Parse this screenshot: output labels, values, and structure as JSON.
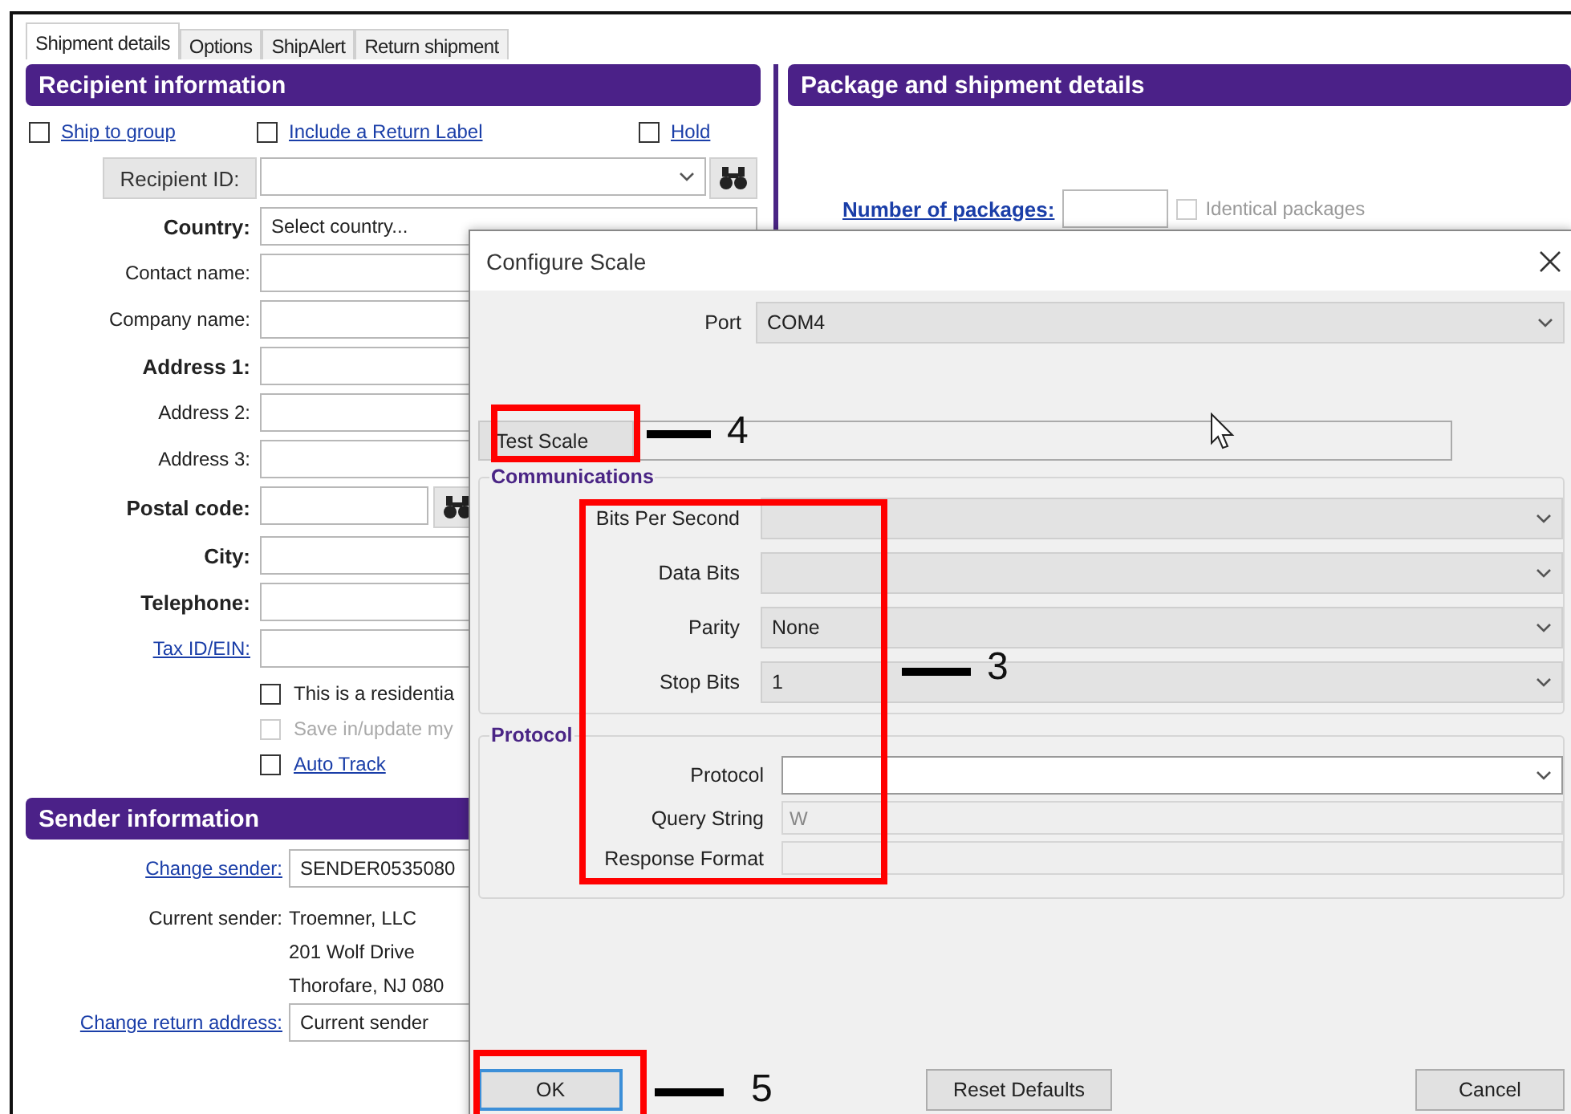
{
  "tabs": [
    {
      "label": "Shipment details",
      "selected": true
    },
    {
      "label": "Options",
      "selected": false
    },
    {
      "label": "ShipAlert",
      "selected": false
    },
    {
      "label": "Return shipment",
      "selected": false
    }
  ],
  "recipient": {
    "title": "Recipient information",
    "options": [
      {
        "label": "Ship to group",
        "checked": false
      },
      {
        "label": "Include a Return Label",
        "checked": false
      },
      {
        "label": "Hold",
        "checked": false
      }
    ],
    "fields": [
      {
        "kind": "lookup_button",
        "label": "Recipient ID:"
      },
      {
        "kind": "required",
        "label": "Country:",
        "value": "Select country..."
      },
      {
        "kind": "optional",
        "label": "Contact name:"
      },
      {
        "kind": "optional",
        "label": "Company name:"
      },
      {
        "kind": "required",
        "label": "Address 1:"
      },
      {
        "kind": "optional",
        "label": "Address 2:"
      },
      {
        "kind": "optional",
        "label": "Address 3:"
      },
      {
        "kind": "postal",
        "label": "Postal code:"
      },
      {
        "kind": "required",
        "label": "City:"
      },
      {
        "kind": "required",
        "label": "Telephone:"
      },
      {
        "kind": "linked",
        "label": "Tax ID/EIN:"
      }
    ],
    "checkboxes": [
      {
        "label": "This is a residentia",
        "checked": false,
        "disabled": false,
        "link": false
      },
      {
        "label": "Save in/update my",
        "checked": false,
        "disabled": true,
        "link": false
      },
      {
        "label": "Auto Track",
        "checked": false,
        "disabled": false,
        "link": true
      }
    ]
  },
  "package": {
    "title": "Package and shipment details",
    "count_label": "Number of packages:",
    "identical": {
      "label": "Identical packages",
      "checked": false,
      "disabled": true
    }
  },
  "sender": {
    "title": "Sender information",
    "change_sender": {
      "label": "Change sender:",
      "value": "SENDER0535080"
    },
    "current_sender": {
      "label": "Current sender:",
      "lines": [
        "Troemner, LLC",
        "201 Wolf Drive",
        "Thorofare, NJ 080"
      ]
    },
    "return_address": {
      "label": "Change return address:",
      "value": "Current sender"
    }
  },
  "dialog": {
    "title": "Configure Scale",
    "port": {
      "label": "Port",
      "value": "COM4"
    },
    "test_button": "Test Scale",
    "communications": {
      "title": "Communications",
      "fields": [
        {
          "label": "Bits Per Second"
        },
        {
          "label": "Data Bits"
        },
        {
          "label": "Parity",
          "value": "None"
        },
        {
          "label": "Stop Bits",
          "value": "1"
        }
      ]
    },
    "protocol": {
      "title": "Protocol",
      "fields": [
        {
          "kind": "combo",
          "label": "Protocol"
        },
        {
          "kind": "readonly",
          "label": "Query String",
          "value": "W"
        },
        {
          "kind": "readonly",
          "label": "Response Format"
        }
      ]
    },
    "buttons": [
      {
        "label": "OK",
        "default": true
      },
      {
        "label": "Reset Defaults",
        "default": false
      },
      {
        "label": "Cancel",
        "default": false
      }
    ]
  },
  "callouts": [
    {
      "number": "4"
    },
    {
      "number": "3"
    },
    {
      "number": "5"
    }
  ]
}
